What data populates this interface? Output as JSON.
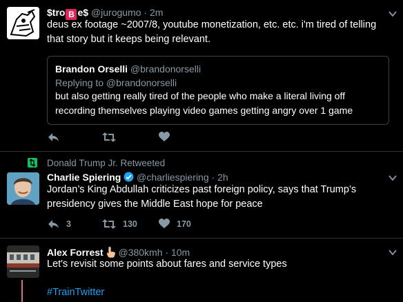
{
  "tweets": [
    {
      "name_part1": "$tro",
      "name_emoji": "B",
      "name_part2": "e$",
      "handle": "@jurogumo",
      "dot": "·",
      "time": "2m",
      "body": "deus ex footage ~2007/8, youtube monetization, etc. etc. i'm tired of telling that story but it keeps being relevant.",
      "quote": {
        "name": "Brandon Orselli",
        "handle": "@brandonorselli",
        "replying": "Replying to @brandonorselli",
        "body": "but also getting really tired of the people who make a literal living off recording themselves playing video games getting angry over 1 game"
      },
      "icons": [
        "reply-icon",
        "retweet-icon",
        "like-icon"
      ]
    },
    {
      "retweeted_by": "Donald Trump Jr. Retweeted",
      "name": "Charlie Spiering",
      "handle": "@charliespiering",
      "dot": "·",
      "time": "2h",
      "body": "Jordan’s King Abdullah criticizes past foreign policy, says that Trump’s presidency gives the Middle East hope for peace",
      "reply_count": "3",
      "retweet_count": "130",
      "like_count": "170"
    },
    {
      "name": "Alex Forrest",
      "handle": "@380kmh",
      "dot": "·",
      "time": "10m",
      "body": "Let's revisit some points about fares and service types",
      "hashtag": "#TrainTwitter"
    }
  ],
  "colors": {
    "background": "#000000",
    "muted": "#8899a6",
    "link": "#1da1f2",
    "verified": "#1da1f2",
    "divider": "#2f3336",
    "retweet_icon": "#17bf63"
  }
}
